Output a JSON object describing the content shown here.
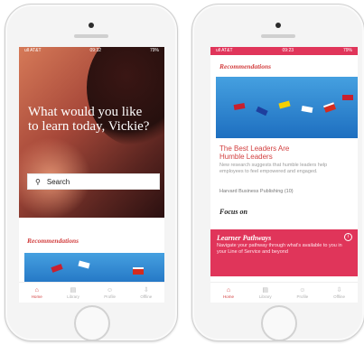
{
  "left_phone": {
    "status": {
      "carrier": "ull AT&T",
      "time": "09:32",
      "battery": "79%"
    },
    "question": "What would you like to learn today, Vickie?",
    "search_label": "Search",
    "recommendations_label": "Recommendations",
    "nav": [
      {
        "label": "Home",
        "icon": "home-icon",
        "active": true
      },
      {
        "label": "Library",
        "icon": "library-icon",
        "active": false
      },
      {
        "label": "Profile",
        "icon": "profile-icon",
        "active": false
      },
      {
        "label": "Offline",
        "icon": "offline-icon",
        "active": false
      }
    ]
  },
  "right_phone": {
    "status": {
      "carrier": "ull AT&T",
      "time": "09:23",
      "battery": "79%"
    },
    "recommendations_label": "Recommendations",
    "article": {
      "title": "The Best Leaders Are Humble Leaders",
      "excerpt": "New research suggests that humble leaders help employees to feel empowered and engaged.",
      "source": "Harvard Business Publishing (10)"
    },
    "focus_label": "Focus on",
    "pathway": {
      "title": "Learner Pathways",
      "description": "Navigate your pathway through what's available to you in your Line of Service and beyond"
    },
    "nav": [
      {
        "label": "Home",
        "icon": "home-icon",
        "active": true
      },
      {
        "label": "Library",
        "icon": "library-icon",
        "active": false
      },
      {
        "label": "Profile",
        "icon": "profile-icon",
        "active": false
      },
      {
        "label": "Offline",
        "icon": "offline-icon",
        "active": false
      }
    ]
  },
  "colors": {
    "accent": "#d23f3f",
    "pathway_bg": "#e0355a"
  }
}
